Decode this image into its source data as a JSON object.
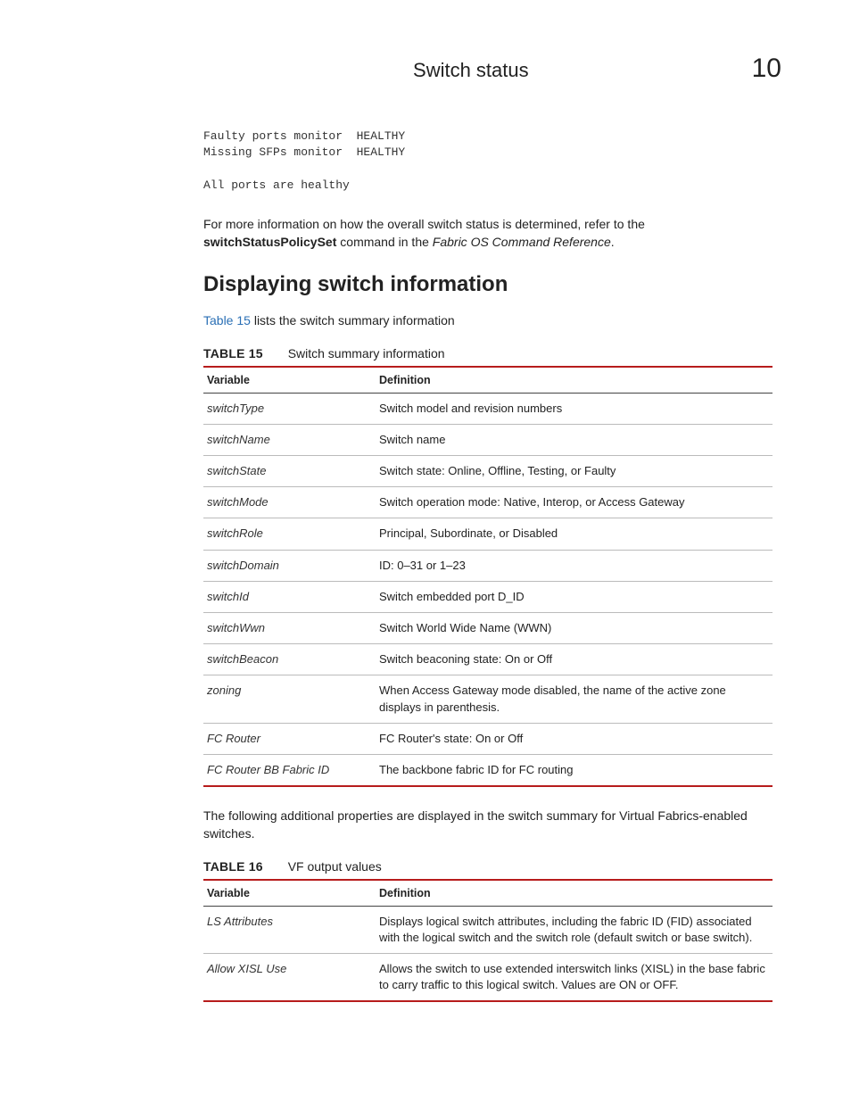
{
  "header": {
    "title": "Switch status",
    "chapter": "10"
  },
  "mono_block": "Faulty ports monitor  HEALTHY\nMissing SFPs monitor  HEALTHY\n\nAll ports are healthy",
  "para1": {
    "lead": "For more information on how the overall switch status is determined, refer to the ",
    "cmd": "switchStatusPolicySet",
    "mid": " command in the ",
    "ref": "Fabric OS Command Reference",
    "tail": "."
  },
  "section_heading": "Displaying switch information",
  "para2": {
    "link": "Table 15",
    "rest": " lists the switch summary information"
  },
  "table15": {
    "label": "TABLE 15",
    "title": "Switch summary information",
    "head_var": "Variable",
    "head_def": "Definition",
    "rows": [
      {
        "v": "switchType",
        "d": "Switch model and revision numbers"
      },
      {
        "v": "switchName",
        "d": "Switch name"
      },
      {
        "v": "switchState",
        "d": "Switch state: Online, Offline, Testing, or Faulty"
      },
      {
        "v": "switchMode",
        "d": "Switch operation mode: Native, Interop, or Access Gateway"
      },
      {
        "v": "switchRole",
        "d": "Principal, Subordinate, or Disabled"
      },
      {
        "v": "switchDomain",
        "d": "ID: 0–31 or 1–23"
      },
      {
        "v": "switchId",
        "d": "Switch embedded port D_ID"
      },
      {
        "v": "switchWwn",
        "d": "Switch World Wide Name (WWN)"
      },
      {
        "v": "switchBeacon",
        "d": "Switch beaconing state: On or Off"
      },
      {
        "v": "zoning",
        "d": "When Access Gateway mode disabled, the name of the active zone displays in parenthesis."
      },
      {
        "v": "FC Router",
        "d": "FC Router's state: On or Off"
      },
      {
        "v": "FC Router BB Fabric ID",
        "d": "The backbone fabric ID for FC routing"
      }
    ]
  },
  "para3": "The following additional properties are displayed in the switch summary for Virtual Fabrics-enabled switches.",
  "table16": {
    "label": "TABLE 16",
    "title": "VF output values",
    "head_var": "Variable",
    "head_def": "Definition",
    "rows": [
      {
        "v": "LS Attributes",
        "d": "Displays logical switch attributes, including the fabric ID (FID) associated with the logical switch and the switch role (default switch or base switch)."
      },
      {
        "v": "Allow XISL Use",
        "d": "Allows the switch to use extended interswitch links (XISL) in the base fabric to carry traffic to this logical switch. Values are ON or OFF."
      }
    ]
  }
}
